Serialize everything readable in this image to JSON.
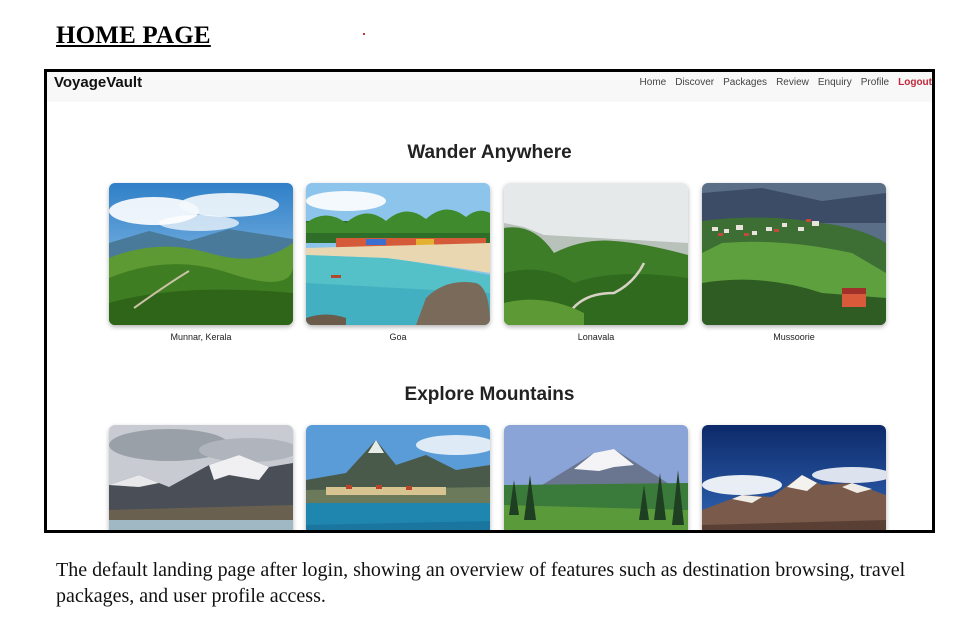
{
  "document": {
    "title": "HOME PAGE",
    "description": "The default landing page after login, showing an overview of features such as destination browsing, travel packages, and user profile access."
  },
  "app": {
    "brand": "VoyageVault",
    "nav": [
      {
        "label": "Home"
      },
      {
        "label": "Discover"
      },
      {
        "label": "Packages"
      },
      {
        "label": "Review"
      },
      {
        "label": "Enquiry"
      },
      {
        "label": "Profile"
      },
      {
        "label": "Logout"
      }
    ],
    "accent_color": "#c0283b"
  },
  "sections": [
    {
      "title": "Wander Anywhere",
      "cards": [
        {
          "caption": "Munnar, Kerala",
          "image": "tea-hills"
        },
        {
          "caption": "Goa",
          "image": "tropical-beach"
        },
        {
          "caption": "Lonavala",
          "image": "green-valley-road"
        },
        {
          "caption": "Mussoorie",
          "image": "hill-town"
        }
      ]
    },
    {
      "title": "Explore Mountains",
      "cards": [
        {
          "caption": "",
          "image": "snow-mountain-lake"
        },
        {
          "caption": "",
          "image": "fjord-peak-village"
        },
        {
          "caption": "",
          "image": "snow-volcano-meadow"
        },
        {
          "caption": "",
          "image": "himalayan-peaks"
        }
      ]
    }
  ]
}
